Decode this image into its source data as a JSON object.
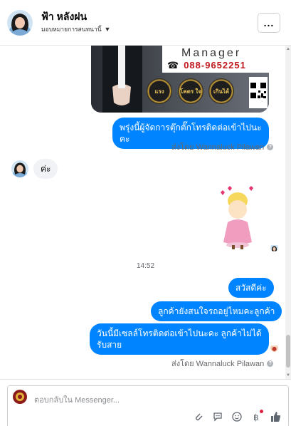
{
  "header": {
    "name": "ฟ้า หลังฝน",
    "subtitle": "มอบหมายการสนทนานี้",
    "more_label": "..."
  },
  "ad": {
    "manager": "Manager",
    "phone": "088-9652251",
    "badges": [
      "แรง",
      "โคตร ใจ",
      "เกินได้"
    ]
  },
  "messages": {
    "out_1": "พรุ่งนี้ผู้จัดการตุ๊กตั๊กโทรติดต่อเข้าไปนะคะ",
    "sent_by_1": "ส่งโดย Wannaluck Pilawan",
    "in_1": "ค่ะ",
    "timestamp": "14:52",
    "out_2": "สวัสดีค่ะ",
    "out_3": "ลูกค้ายังสนใจรถอยู่ไหมคะลูกค้า",
    "out_4": "วันนี้มีเซลล์โทรติดต่อเข้าไปนะคะ ลูกค้าไม่ได้รับสาย",
    "sent_by_2": "ส่งโดย Wannaluck Pilawan"
  },
  "composer": {
    "placeholder": "ตอบกลับใน Messenger..."
  },
  "colors": {
    "messenger_blue": "#0084ff",
    "incoming_gray": "#f0f2f5"
  },
  "icons": [
    "more-icon",
    "caret-down-icon",
    "phone-icon",
    "help-icon",
    "attachment-icon",
    "saved-reply-icon",
    "emoji-icon",
    "dollar-icon",
    "like-icon"
  ]
}
